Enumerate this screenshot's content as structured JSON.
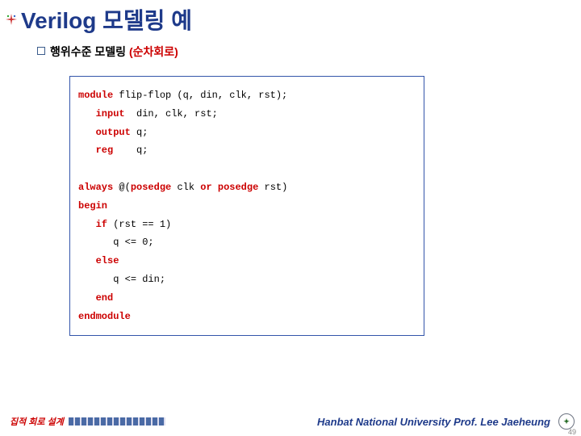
{
  "title": "Verilog 모델링 예",
  "subtitle_prefix": "행위수준 모델링 ",
  "subtitle_highlight": "(순차회로)",
  "code": {
    "l1_kw": "module",
    "l1_rest": " flip-flop (q, din, clk, rst);",
    "l2_kw": "input",
    "l2_rest": "  din, clk, rst;",
    "l3_kw": "output",
    "l3_rest": " q;",
    "l4_kw": "reg",
    "l4_rest": "    q;",
    "l5_kw1": "always",
    "l5_mid": " @(",
    "l5_kw2": "posedge",
    "l5_a": " clk ",
    "l5_kw3": "or",
    "l5_b": " ",
    "l5_kw4": "posedge",
    "l5_c": " rst)",
    "l6_kw": "begin",
    "l7_kw": "if",
    "l7_rest": " (rst == 1)",
    "l8": "q <= 0;",
    "l9_kw": "else",
    "l10": "q <= din;",
    "l11_kw": "end",
    "l12_kw": "endmodule"
  },
  "footer_left": "집적 회로 설계",
  "footer_right": "Hanbat National University Prof. Lee Jaeheung",
  "page_number": "49"
}
